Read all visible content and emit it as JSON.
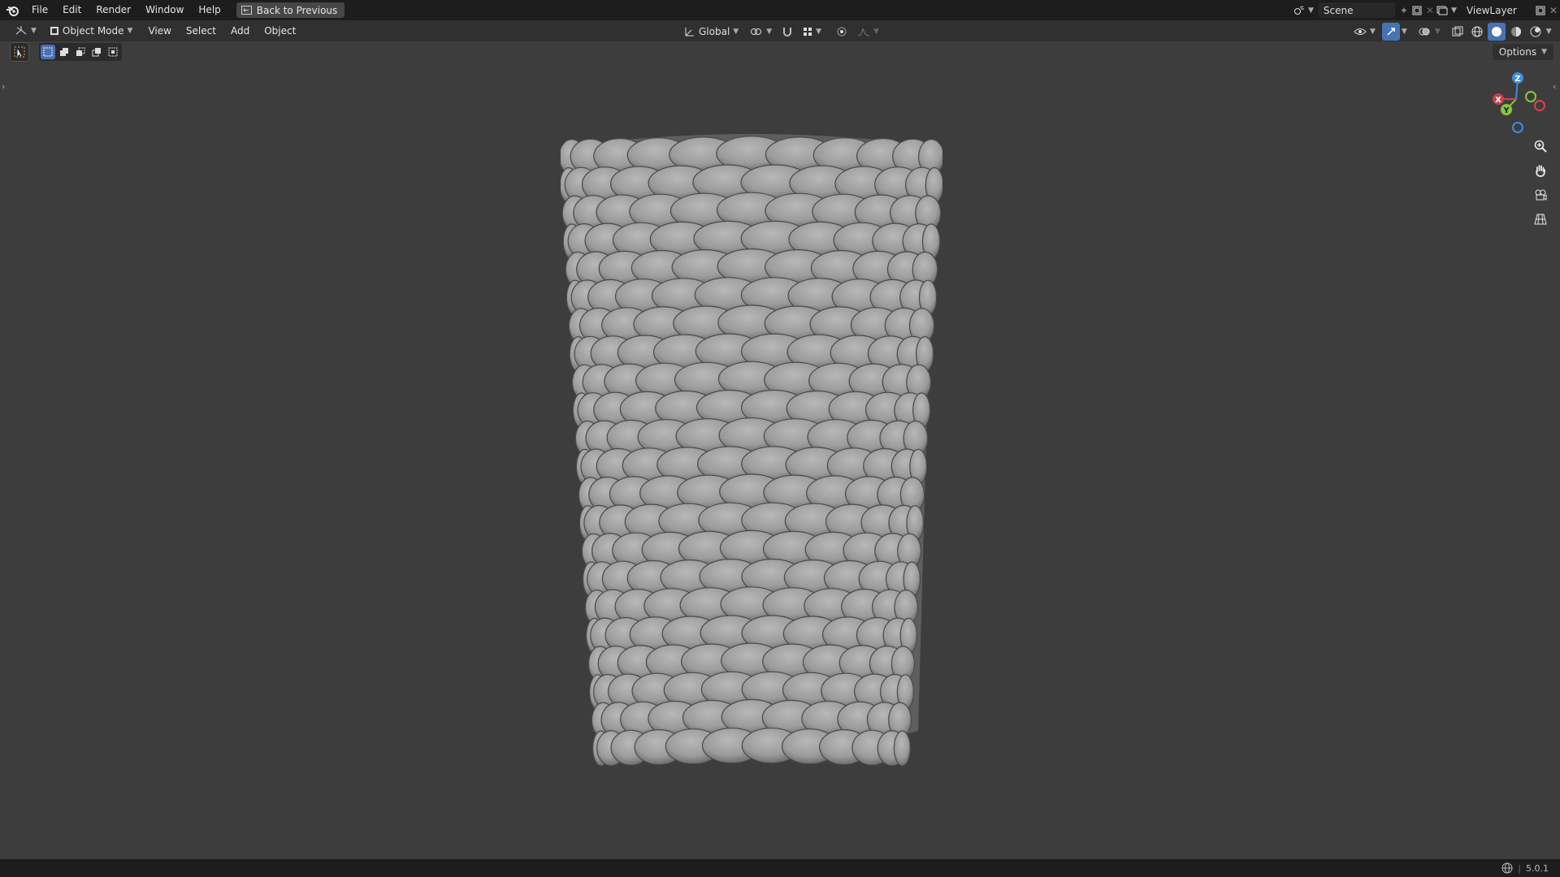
{
  "topbar": {
    "menus": [
      "File",
      "Edit",
      "Render",
      "Window",
      "Help"
    ],
    "back_label": "Back to Previous",
    "scene_label": "Scene",
    "viewlayer_label": "ViewLayer"
  },
  "header": {
    "mode_label": "Object Mode",
    "menus": [
      "View",
      "Select",
      "Add",
      "Object"
    ],
    "orientation_label": "Global"
  },
  "viewport": {
    "options_label": "Options",
    "gizmo": {
      "z": "Z",
      "y": "Y",
      "x": "X"
    },
    "object_icon": "corn-cob-mesh"
  },
  "status": {
    "version": "5.0.1"
  },
  "colors": {
    "accent": "#4772b3",
    "axis_x": "#d9414f",
    "axis_y": "#88c640",
    "axis_z": "#3d8fdc"
  }
}
